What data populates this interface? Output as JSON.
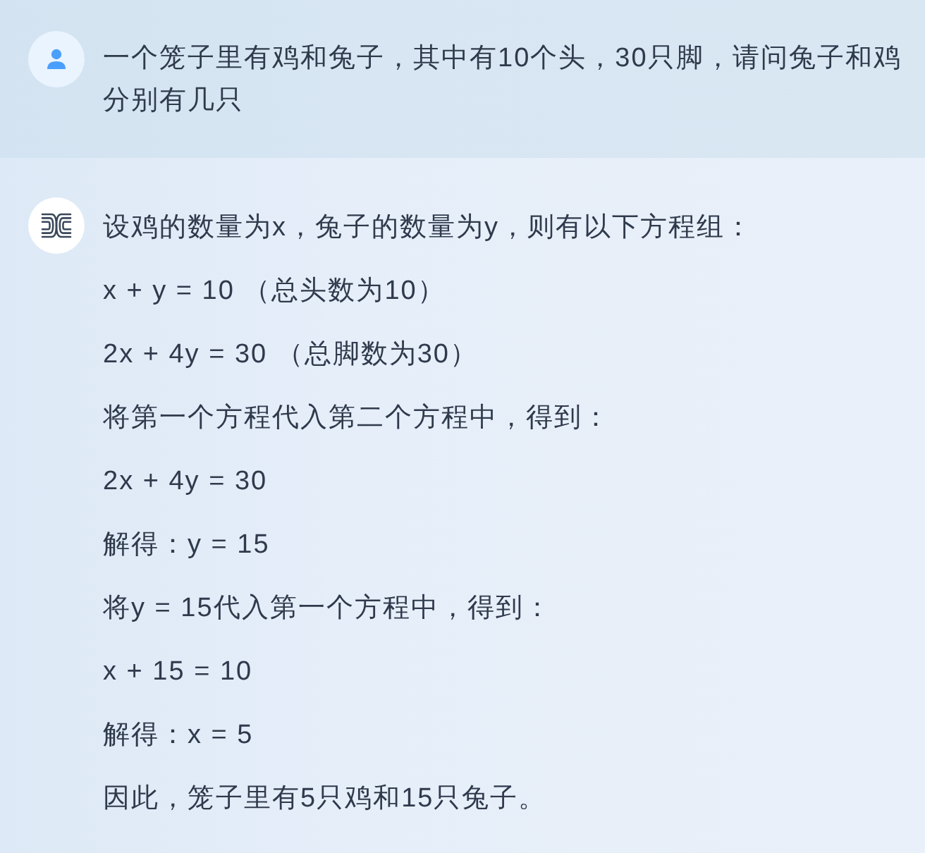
{
  "messages": [
    {
      "kind": "user",
      "paragraphs": [
        "一个笼子里有鸡和兔子，其中有10个头，30只脚，请问兔子和鸡分别有几只"
      ]
    },
    {
      "kind": "assistant",
      "paragraphs": [
        "设鸡的数量为x，兔子的数量为y，则有以下方程组：",
        "x + y = 10 （总头数为10）",
        "2x + 4y = 30 （总脚数为30）",
        "将第一个方程代入第二个方程中，得到：",
        "2x + 4y = 30",
        "解得：y = 15",
        "将y = 15代入第一个方程中，得到：",
        "x + 15 = 10",
        "解得：x = 5",
        "因此，笼子里有5只鸡和15只兔子。"
      ]
    }
  ]
}
